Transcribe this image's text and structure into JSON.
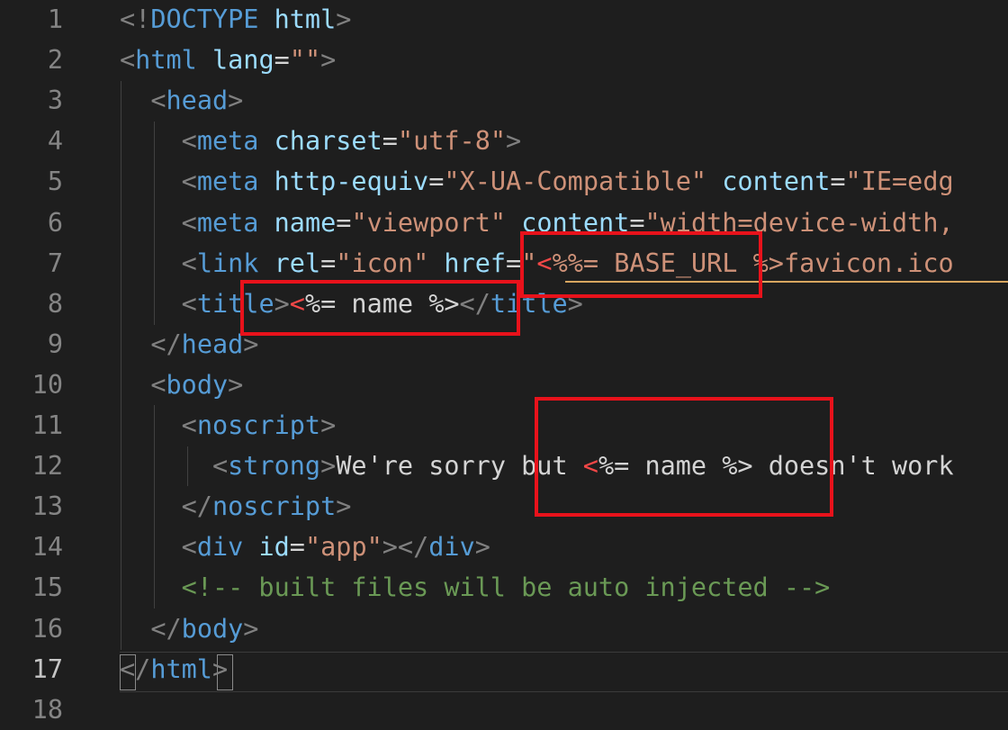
{
  "editor": {
    "line_numbers": [
      "1",
      "2",
      "3",
      "4",
      "5",
      "6",
      "7",
      "8",
      "9",
      "10",
      "11",
      "12",
      "13",
      "14",
      "15",
      "16",
      "17",
      "18"
    ],
    "active_line": "17",
    "lines": [
      [
        [
          "pu",
          "<!"
        ],
        [
          "dt",
          "DOCTYPE"
        ],
        [
          "tx",
          " "
        ],
        [
          "at",
          "html"
        ],
        [
          "pu",
          ">"
        ]
      ],
      [
        [
          "pu",
          "<"
        ],
        [
          "tg",
          "html"
        ],
        [
          "tx",
          " "
        ],
        [
          "at",
          "lang"
        ],
        [
          "tx",
          "="
        ],
        [
          "st",
          "\"\""
        ],
        [
          "pu",
          ">"
        ]
      ],
      [
        [
          "tx",
          "  "
        ],
        [
          "pu",
          "<"
        ],
        [
          "tg",
          "head"
        ],
        [
          "pu",
          ">"
        ]
      ],
      [
        [
          "tx",
          "    "
        ],
        [
          "pu",
          "<"
        ],
        [
          "tg",
          "meta"
        ],
        [
          "tx",
          " "
        ],
        [
          "at",
          "charset"
        ],
        [
          "tx",
          "="
        ],
        [
          "st",
          "\"utf-8\""
        ],
        [
          "pu",
          ">"
        ]
      ],
      [
        [
          "tx",
          "    "
        ],
        [
          "pu",
          "<"
        ],
        [
          "tg",
          "meta"
        ],
        [
          "tx",
          " "
        ],
        [
          "at",
          "http-equiv"
        ],
        [
          "tx",
          "="
        ],
        [
          "st",
          "\"X-UA-Compatible\""
        ],
        [
          "tx",
          " "
        ],
        [
          "at",
          "content"
        ],
        [
          "tx",
          "="
        ],
        [
          "st",
          "\"IE=edg"
        ]
      ],
      [
        [
          "tx",
          "    "
        ],
        [
          "pu",
          "<"
        ],
        [
          "tg",
          "meta"
        ],
        [
          "tx",
          " "
        ],
        [
          "at",
          "name"
        ],
        [
          "tx",
          "="
        ],
        [
          "st",
          "\"viewport\""
        ],
        [
          "tx",
          " "
        ],
        [
          "at",
          "content"
        ],
        [
          "tx",
          "="
        ],
        [
          "st",
          "\"width=device-width,"
        ]
      ],
      [
        [
          "tx",
          "    "
        ],
        [
          "pu",
          "<"
        ],
        [
          "tg",
          "link"
        ],
        [
          "tx",
          " "
        ],
        [
          "at",
          "rel"
        ],
        [
          "tx",
          "="
        ],
        [
          "st",
          "\"icon\""
        ],
        [
          "tx",
          " "
        ],
        [
          "at",
          "href"
        ],
        [
          "tx",
          "="
        ],
        [
          "st",
          "\""
        ],
        [
          "rd",
          "<"
        ],
        [
          "st",
          "%%= BASE_URL %>favicon.ico"
        ]
      ],
      [
        [
          "tx",
          "    "
        ],
        [
          "pu",
          "<"
        ],
        [
          "tg",
          "title"
        ],
        [
          "pu",
          ">"
        ],
        [
          "rd",
          "<"
        ],
        [
          "tx",
          "%= name %>"
        ],
        [
          "pu",
          "</"
        ],
        [
          "tg",
          "title"
        ],
        [
          "pu",
          ">"
        ]
      ],
      [
        [
          "tx",
          "  "
        ],
        [
          "pu",
          "</"
        ],
        [
          "tg",
          "head"
        ],
        [
          "pu",
          ">"
        ]
      ],
      [
        [
          "tx",
          "  "
        ],
        [
          "pu",
          "<"
        ],
        [
          "tg",
          "body"
        ],
        [
          "pu",
          ">"
        ]
      ],
      [
        [
          "tx",
          "    "
        ],
        [
          "pu",
          "<"
        ],
        [
          "tg",
          "noscript"
        ],
        [
          "pu",
          ">"
        ]
      ],
      [
        [
          "tx",
          "      "
        ],
        [
          "pu",
          "<"
        ],
        [
          "tg",
          "strong"
        ],
        [
          "pu",
          ">"
        ],
        [
          "tx",
          "We're sorry but "
        ],
        [
          "rd",
          "<"
        ],
        [
          "tx",
          "%= name %> doesn't work"
        ]
      ],
      [
        [
          "tx",
          "    "
        ],
        [
          "pu",
          "</"
        ],
        [
          "tg",
          "noscript"
        ],
        [
          "pu",
          ">"
        ]
      ],
      [
        [
          "tx",
          "    "
        ],
        [
          "pu",
          "<"
        ],
        [
          "tg",
          "div"
        ],
        [
          "tx",
          " "
        ],
        [
          "at",
          "id"
        ],
        [
          "tx",
          "="
        ],
        [
          "st",
          "\"app\""
        ],
        [
          "pu",
          "></"
        ],
        [
          "tg",
          "div"
        ],
        [
          "pu",
          ">"
        ]
      ],
      [
        [
          "tx",
          "    "
        ],
        [
          "cm",
          "<!-- built files will be auto injected -->"
        ]
      ],
      [
        [
          "tx",
          "  "
        ],
        [
          "pu",
          "</"
        ],
        [
          "tg",
          "body"
        ],
        [
          "pu",
          ">"
        ]
      ],
      [
        [
          "pu",
          "</"
        ],
        [
          "tg",
          "html"
        ],
        [
          "pu",
          ">"
        ]
      ],
      [
        [
          "tx",
          ""
        ]
      ]
    ]
  },
  "colors": {
    "background": "#1e1e1e",
    "tag": "#569cd6",
    "attribute": "#9cdcfe",
    "string": "#ce9178",
    "comment": "#6a9955",
    "punctuation": "#808080",
    "highlight_box": "#e8121b",
    "error_char": "#f44747"
  }
}
